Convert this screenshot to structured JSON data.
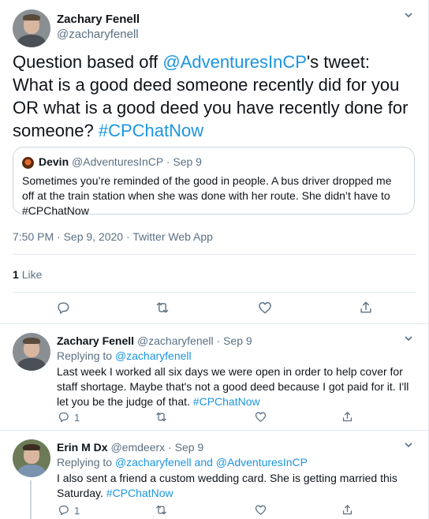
{
  "main_tweet": {
    "author_name": "Zachary Fenell",
    "author_handle": "@zacharyfenell",
    "text_prefix": "Question based off ",
    "text_mention": "@AdventuresInCP",
    "text_body": "'s tweet: What is a good deed someone recently did for you OR what is a good deed you have recently done for someone? ",
    "text_hashtag": "#CPChatNow",
    "quoted": {
      "author_name": "Devin",
      "author_handle": "@AdventuresInCP",
      "dot": "·",
      "date": "Sep 9",
      "text": "Sometimes you’re reminded of the good in people. A bus driver dropped me off at the train station when she was done with her route. She didn’t have to #CPChatNow"
    },
    "meta": "7:50 PM · Sep 9, 2020 · Twitter Web App",
    "likes_count": "1",
    "likes_label": "Like"
  },
  "replies": [
    {
      "author_name": "Zachary Fenell",
      "author_handle": "@zacharyfenell",
      "dot": "·",
      "date": "Sep 9",
      "replying_prefix": "Replying to ",
      "replying_to": "@zacharyfenell",
      "text_body": "Last week I worked all six days we were open in order to help cover for staff shortage. Maybe that's not a good deed because I got paid for it. I'll let you be the judge of that. ",
      "text_hashtag": "#CPChatNow",
      "reply_count": "1"
    },
    {
      "author_name": "Erin M Dx",
      "author_handle": "@emdeerx",
      "dot": "·",
      "date": "Sep 9",
      "replying_prefix": "Replying to ",
      "replying_to_1": "@zacharyfenell",
      "replying_and": " and ",
      "replying_to_2": "@AdventuresInCP",
      "text_body": "I also sent a friend a custom wedding card. She is getting married this Saturday. ",
      "text_hashtag": "#CPChatNow",
      "reply_count": "1"
    }
  ],
  "icons": [
    "chevron-down-icon",
    "reply-icon",
    "retweet-icon",
    "like-icon",
    "share-icon"
  ],
  "colors": {
    "link": "#1b95e0",
    "secondary": "#5b7083",
    "border": "#e1e8ed"
  }
}
